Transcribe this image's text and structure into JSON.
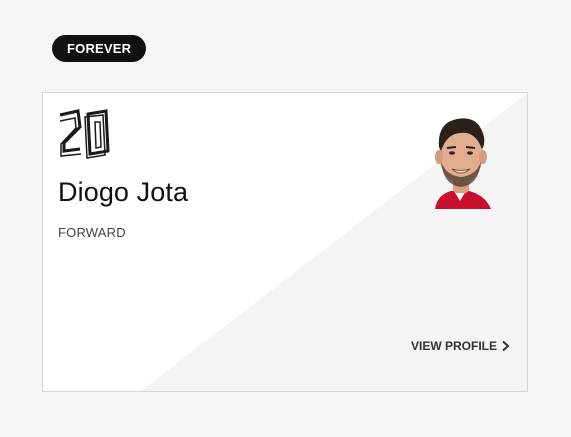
{
  "badge": {
    "label": "FOREVER"
  },
  "player": {
    "number": "20",
    "name": "Diogo Jota",
    "position": "FORWARD"
  },
  "actions": {
    "view_profile": "VIEW PROFILE"
  },
  "icons": {
    "view_profile_chevron": "chevron-right-icon"
  },
  "colors": {
    "page_bg": "#f5f5f5",
    "card_bg": "#ffffff",
    "card_shade": "#f4f4f4",
    "badge_bg": "#111111",
    "text_primary": "#111111",
    "text_secondary": "#444444"
  }
}
